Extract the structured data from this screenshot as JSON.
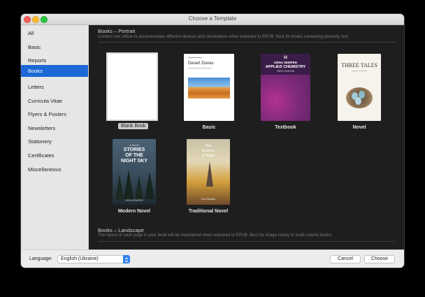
{
  "window": {
    "title": "Choose a Template"
  },
  "sidebar": {
    "items": [
      {
        "label": "All"
      },
      {
        "label": "Basic"
      },
      {
        "label": "Reports"
      },
      {
        "label": "Books",
        "selected": true
      },
      {
        "label": "Letters"
      },
      {
        "label": "Curricula Vitae"
      },
      {
        "label": "Flyers & Posters"
      },
      {
        "label": "Newsletters"
      },
      {
        "label": "Stationery"
      },
      {
        "label": "Certificates"
      },
      {
        "label": "Miscellaneous"
      }
    ]
  },
  "portrait": {
    "title": "Books – Portrait",
    "description": "Content can reflow to accommodate different devices and orientations when exported to EPUB. Best for books containing primarily text."
  },
  "templates": {
    "blank": {
      "label": "Blank Book"
    },
    "basic": {
      "label": "Basic",
      "cover_title": "Desert Dunes"
    },
    "textbook": {
      "label": "Textbook",
      "cover_author": "URNA SEMPER",
      "cover_title": "APPLIED CHEMISTRY",
      "cover_edition": "FIRST EDITION"
    },
    "novel": {
      "label": "Novel",
      "cover_title": "THREE TALES"
    },
    "modern_novel": {
      "label": "Modern Novel",
      "cover_kicker": "A Novel",
      "cover_title_1": "STORIES",
      "cover_title_2": "OF THE",
      "cover_title_3": "NIGHT SKY",
      "cover_author": "URNA SEMPER"
    },
    "traditional_novel": {
      "label": "Traditional Novel",
      "cover_title_1": "The",
      "cover_title_2": "Seasons",
      "cover_title_3": "of Paris",
      "cover_author": "Urna Semper"
    }
  },
  "landscape": {
    "title": "Books – Landscape",
    "description": "The layout of each page in your book will be maintained when exported to EPUB. Best for image-heavy or multi-column books."
  },
  "footer": {
    "language_label": "Language:",
    "language_value": "English (Ukraine)",
    "cancel_label": "Cancel",
    "choose_label": "Choose"
  },
  "colors": {
    "accent": "#1b68d6",
    "content_bg": "#1e1e1e",
    "sidebar_bg": "#e6e6e6"
  }
}
